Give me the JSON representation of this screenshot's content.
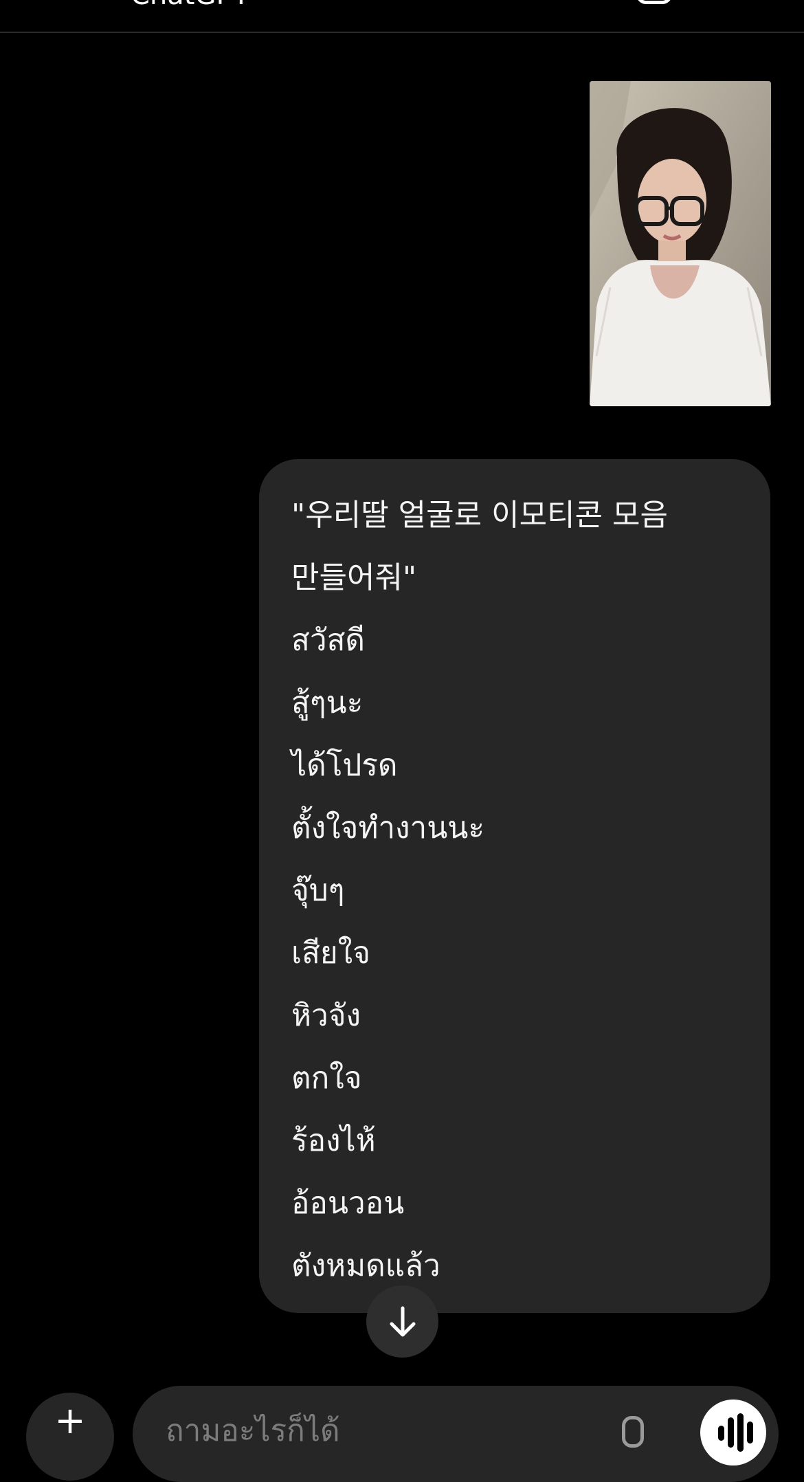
{
  "header": {
    "title": "ChatGPT",
    "icon": "new-chat-icon"
  },
  "conversation": {
    "photo_icon": "user-photo",
    "message_lines": [
      "\"우리딸 얼굴로 이모티콘 모음",
      "만들어줘\"",
      "สวัสดี",
      "สู้ๆนะ",
      "ได้โปรด",
      "ตั้งใจทำงานนะ",
      "จุ๊บๆ",
      "เสียใจ",
      "หิวจัง",
      "ตกใจ",
      "ร้องไห้",
      "อ้อนวอน",
      "ตังหมดแล้ว"
    ],
    "scroll_down_icon": "arrow-down-icon"
  },
  "composer": {
    "add_icon": "plus-icon",
    "add_symbol": "+",
    "placeholder": "ถามอะไรก็ได้",
    "mic_icon": "microphone-icon",
    "voice_icon": "voice-mode-icon"
  },
  "colors": {
    "background": "#000000",
    "bubble": "#262626",
    "text": "#f4f4f4",
    "placeholder": "#7c7c7c"
  }
}
